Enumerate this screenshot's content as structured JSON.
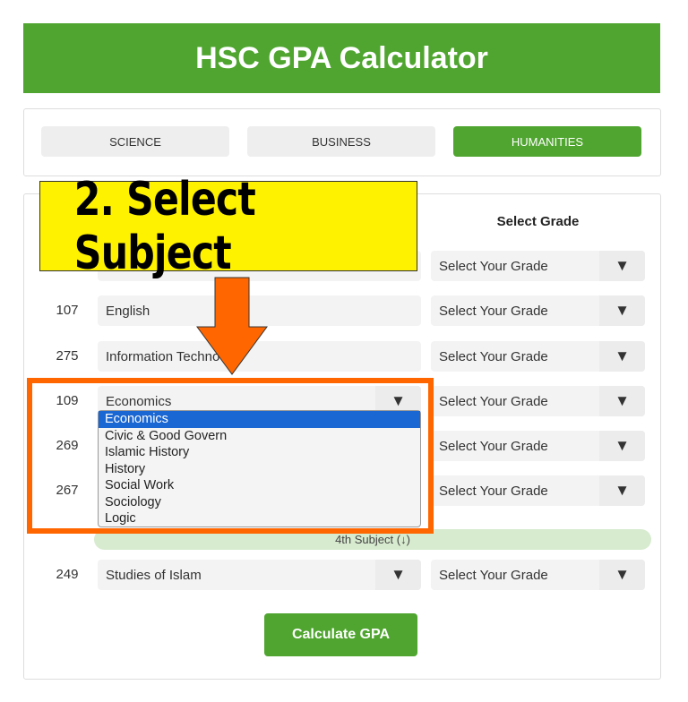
{
  "title": "HSC GPA Calculator",
  "tabs": [
    {
      "label": "SCIENCE"
    },
    {
      "label": "BUSINESS"
    },
    {
      "label": "HUMANITIES",
      "active": true
    }
  ],
  "grade_header": "Select Grade",
  "rows": [
    {
      "code": "",
      "subject": "",
      "grade": "Select Your Grade"
    },
    {
      "code": "107",
      "subject": "English",
      "grade": "Select Your Grade"
    },
    {
      "code": "275",
      "subject": "Information Techno",
      "grade": "Select Your Grade"
    },
    {
      "code": "109",
      "subject": "Economics",
      "grade": "Select Your Grade"
    },
    {
      "code": "269",
      "subject": "",
      "grade": "Select Your Grade"
    },
    {
      "code": "267",
      "subject": "",
      "grade": "Select Your Grade"
    }
  ],
  "dropdown_options": [
    "Economics",
    "Civic & Good Govern",
    "Islamic History",
    "History",
    "Social Work",
    "Sociology",
    "Logic"
  ],
  "fourth_subject_label": "4th Subject (↓)",
  "fourth_row": {
    "code": "249",
    "subject": "Studies of Islam",
    "grade": "Select Your Grade"
  },
  "calculate_label": "Calculate GPA",
  "annotation": "2. Select Subject",
  "colors": {
    "brand": "#4fa52f",
    "annotation_bg": "#fff200",
    "highlight": "#ff6600",
    "selected_option": "#1a66d2"
  }
}
